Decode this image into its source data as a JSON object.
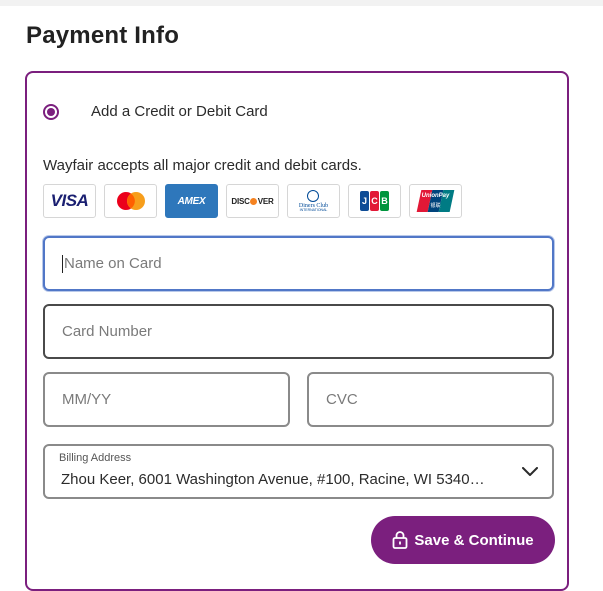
{
  "page": {
    "title": "Payment Info"
  },
  "payment_option": {
    "label": "Add a Credit or Debit Card",
    "selected": true
  },
  "accepts_text": "Wayfair accepts all major credit and debit cards.",
  "card_logos": [
    {
      "name": "visa",
      "text": "VISA"
    },
    {
      "name": "mastercard",
      "text": ""
    },
    {
      "name": "amex",
      "text": "AMEX"
    },
    {
      "name": "discover",
      "text": "DISCOVER"
    },
    {
      "name": "diners-club",
      "text": "Diners Club",
      "subtext": "INTERNATIONAL"
    },
    {
      "name": "jcb",
      "text": "JCB"
    },
    {
      "name": "unionpay",
      "text": "UnionPay",
      "subtext": "银联"
    }
  ],
  "form": {
    "name_on_card": {
      "value": "",
      "placeholder": "Name on Card"
    },
    "card_number": {
      "value": "",
      "placeholder": "Card Number"
    },
    "expiry": {
      "value": "",
      "placeholder": "MM/YY"
    },
    "cvc": {
      "value": "",
      "placeholder": "CVC"
    },
    "billing_address": {
      "label": "Billing Address",
      "value": "Zhou Keer, 6001 Washington Avenue, #100, Racine, WI 5340…"
    }
  },
  "actions": {
    "save_label": "Save & Continue",
    "save_icon": "lock-icon"
  },
  "colors": {
    "accent": "#7b1f7e",
    "focus": "#5177c7",
    "amex": "#2e77bb"
  }
}
